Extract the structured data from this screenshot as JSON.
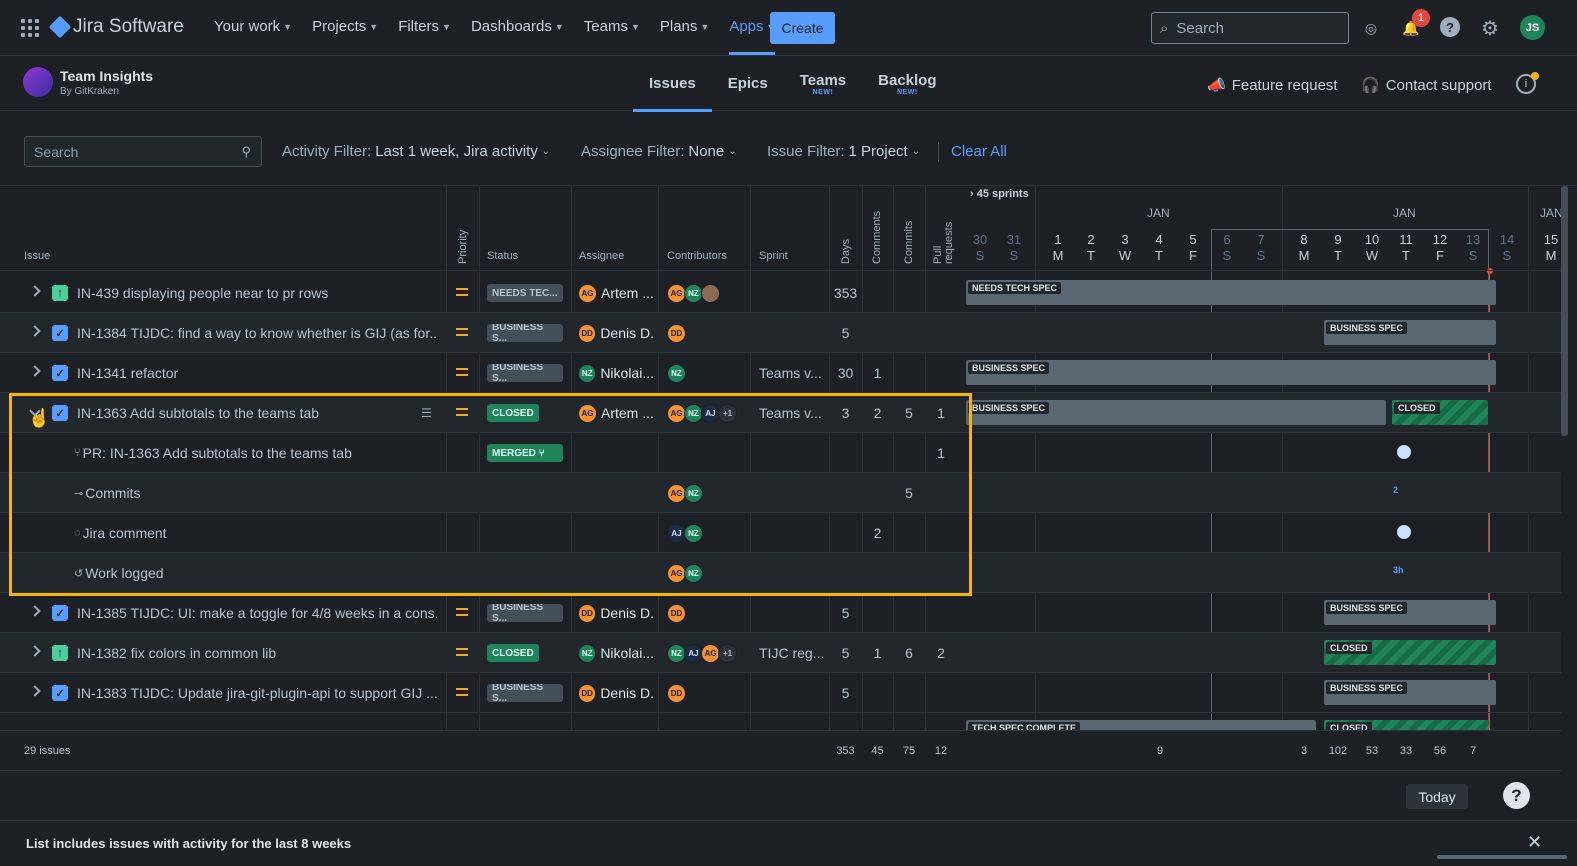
{
  "topnav": {
    "product": "Jira Software",
    "menu": [
      "Your work",
      "Projects",
      "Filters",
      "Dashboards",
      "Teams",
      "Plans",
      "Apps"
    ],
    "create": "Create",
    "search_placeholder": "Search",
    "notifications": "1",
    "user_initials": "JS"
  },
  "app": {
    "name": "Team Insights",
    "by": "By GitKraken",
    "tabs": [
      {
        "label": "Issues",
        "new": ""
      },
      {
        "label": "Epics",
        "new": ""
      },
      {
        "label": "Teams",
        "new": "NEW!"
      },
      {
        "label": "Backlog",
        "new": "NEW!"
      }
    ],
    "feature_request": "Feature request",
    "contact_support": "Contact support"
  },
  "filters": {
    "search_placeholder": "Search",
    "activity_label": "Activity Filter:",
    "activity_value": "Last 1 week, Jira activity",
    "assignee_label": "Assignee Filter:",
    "assignee_value": "None",
    "issue_label": "Issue Filter:",
    "issue_value": "1 Project",
    "clear_all": "Clear All"
  },
  "columns": {
    "issue": "Issue",
    "priority": "Priority",
    "status": "Status",
    "assignee": "Assignee",
    "contributors": "Contributors",
    "sprint": "Sprint",
    "days": "Days",
    "comments": "Comments",
    "commits": "Commits",
    "pull_requests": "Pull requests"
  },
  "timeline": {
    "sprints": "45 sprints",
    "month1": "JAN",
    "month2": "JAN",
    "month3": "JAN",
    "days": [
      {
        "d": "30",
        "w": "S"
      },
      {
        "d": "31",
        "w": "S"
      },
      {
        "d": "1",
        "w": "M"
      },
      {
        "d": "2",
        "w": "T"
      },
      {
        "d": "3",
        "w": "W"
      },
      {
        "d": "4",
        "w": "T"
      },
      {
        "d": "5",
        "w": "F"
      },
      {
        "d": "6",
        "w": "S"
      },
      {
        "d": "7",
        "w": "S"
      },
      {
        "d": "8",
        "w": "M"
      },
      {
        "d": "9",
        "w": "T"
      },
      {
        "d": "10",
        "w": "W"
      },
      {
        "d": "11",
        "w": "T"
      },
      {
        "d": "12",
        "w": "F"
      },
      {
        "d": "13",
        "w": "S"
      },
      {
        "d": "14",
        "w": "S"
      },
      {
        "d": "15",
        "w": "M"
      }
    ]
  },
  "rows": [
    {
      "key": "IN-439 displaying people near to pr rows",
      "type": "story",
      "status": "NEEDS TEC...",
      "assignee": "Artem ...",
      "assignee_av": "AG",
      "contrib": [
        "AG",
        "NZ",
        "ph"
      ],
      "sprint": "",
      "days": "353",
      "comments": "",
      "commits": "",
      "prs": "",
      "bar": "NEEDS TECH SPEC"
    },
    {
      "key": "IN-1384 TIJDC: find a way to know whether is GIJ (as for...",
      "type": "task",
      "status": "BUSINESS S...",
      "assignee": "Denis D.",
      "assignee_av": "DD",
      "contrib": [
        "DD"
      ],
      "sprint": "",
      "days": "5",
      "comments": "",
      "commits": "",
      "prs": "",
      "bar": "BUSINESS SPEC"
    },
    {
      "key": "IN-1341 refactor",
      "type": "task",
      "status": "BUSINESS S...",
      "assignee": "Nikolai...",
      "assignee_av": "NZ",
      "contrib": [
        "NZ"
      ],
      "sprint": "Teams v...",
      "days": "30",
      "comments": "1",
      "commits": "",
      "prs": "",
      "bar": "BUSINESS SPEC"
    },
    {
      "key": "IN-1363 Add subtotals to the teams tab",
      "type": "task",
      "status": "CLOSED",
      "assignee": "Artem ...",
      "assignee_av": "AG",
      "contrib": [
        "AG",
        "NZ",
        "AJ",
        "+1"
      ],
      "sprint": "Teams v...",
      "days": "3",
      "comments": "2",
      "commits": "5",
      "prs": "1",
      "bar": "BUSINESS SPEC",
      "bar2": "CLOSED"
    },
    {
      "key": "PR: IN-1363 Add subtotals to the teams tab",
      "sub": true,
      "status": "MERGED",
      "prs": "1"
    },
    {
      "key": "Commits",
      "sub": true,
      "contrib": [
        "AG",
        "NZ"
      ],
      "commits": "5",
      "mark": "2"
    },
    {
      "key": "Jira comment",
      "sub": true,
      "contrib": [
        "AJ",
        "NZ"
      ],
      "comments": "2"
    },
    {
      "key": "Work logged",
      "sub": true,
      "contrib": [
        "AG",
        "NZ"
      ],
      "mark": "3h"
    },
    {
      "key": "IN-1385 TIJDC: UI: make a toggle for 4/8 weeks in a cons...",
      "type": "task",
      "status": "BUSINESS S...",
      "assignee": "Denis D.",
      "assignee_av": "DD",
      "contrib": [
        "DD"
      ],
      "sprint": "",
      "days": "5",
      "comments": "",
      "commits": "",
      "prs": "",
      "bar": "BUSINESS SPEC"
    },
    {
      "key": "IN-1382 fix colors in common lib",
      "type": "story",
      "status": "CLOSED",
      "assignee": "Nikolai...",
      "assignee_av": "NZ",
      "contrib": [
        "NZ",
        "AJ",
        "AG",
        "+1"
      ],
      "sprint": "TIJC reg...",
      "days": "5",
      "comments": "1",
      "commits": "6",
      "prs": "2",
      "bar": "CLOSED"
    },
    {
      "key": "IN-1383 TIJDC: Update jira-git-plugin-api to support GIJ ...",
      "type": "task",
      "status": "BUSINESS S...",
      "assignee": "Denis D.",
      "assignee_av": "DD",
      "contrib": [
        "DD"
      ],
      "sprint": "",
      "days": "5",
      "comments": "",
      "commits": "",
      "prs": "",
      "bar": "BUSINESS SPEC"
    }
  ],
  "last_row_bars": [
    "TECH SPEC COMPLETE",
    "CLOSED"
  ],
  "footer": {
    "count": "29 issues",
    "days": "353",
    "comments": "45",
    "commits": "75",
    "prs": "12",
    "week1": "9",
    "daytotals": [
      "3",
      "102",
      "53",
      "33",
      "56",
      "7"
    ]
  },
  "today": "Today",
  "bottom_note": "List includes issues with activity for the last 8 weeks",
  "colors": {
    "accent": "#579dff",
    "highlight": "#f5b50e",
    "closed": "#1f845a",
    "priority": "#f5a623"
  }
}
